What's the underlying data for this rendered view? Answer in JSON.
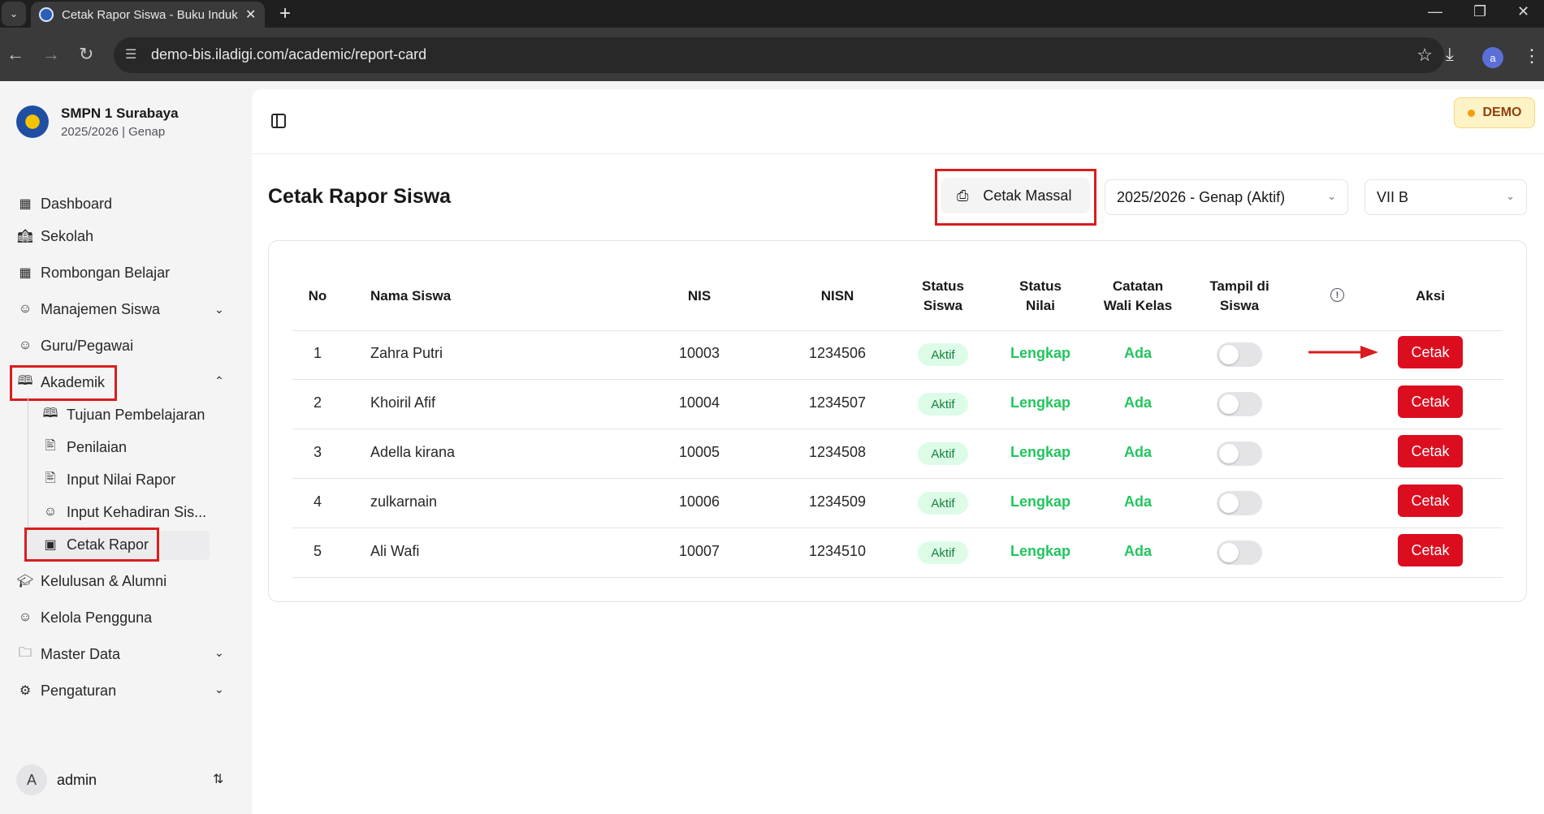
{
  "browser": {
    "tab_title": "Cetak Rapor Siswa - Buku Induk",
    "url": "demo-bis.iladigi.com/academic/report-card",
    "profile_initial": "a"
  },
  "school": {
    "name": "SMPN 1 Surabaya",
    "period": "2025/2026 | Genap"
  },
  "sidebar": {
    "items": [
      {
        "label": "Dashboard",
        "icon": "grid-icon"
      },
      {
        "label": "Sekolah",
        "icon": "school-icon"
      },
      {
        "label": "Rombongan Belajar",
        "icon": "grid-icon"
      },
      {
        "label": "Manajemen Siswa",
        "icon": "users-icon"
      },
      {
        "label": "Guru/Pegawai",
        "icon": "users-icon"
      },
      {
        "label": "Akademik",
        "icon": "book-open-icon"
      },
      {
        "label": "Kelulusan & Alumni",
        "icon": "graduation-cap-icon"
      },
      {
        "label": "Kelola Pengguna",
        "icon": "user-cog-icon"
      },
      {
        "label": "Master Data",
        "icon": "folder-icon"
      },
      {
        "label": "Pengaturan",
        "icon": "gear-icon"
      }
    ],
    "akademik_sub": [
      {
        "label": "Tujuan Pembelajaran",
        "icon": "book-open-icon"
      },
      {
        "label": "Penilaian",
        "icon": "file-text-icon"
      },
      {
        "label": "Input Nilai Rapor",
        "icon": "file-text-icon"
      },
      {
        "label": "Input Kehadiran Sis...",
        "icon": "users-icon"
      },
      {
        "label": "Cetak Rapor",
        "icon": "badge-icon"
      }
    ]
  },
  "user": {
    "initial": "A",
    "name": "admin"
  },
  "header": {
    "demo_label": "DEMO"
  },
  "page": {
    "title": "Cetak Rapor Siswa",
    "bulk_print_label": "Cetak Massal",
    "semester_selected": "2025/2026 - Genap (Aktif)",
    "class_selected": "VII B"
  },
  "table": {
    "headers": {
      "no": "No",
      "nama": "Nama Siswa",
      "nis": "NIS",
      "nisn": "NISN",
      "status_siswa_1": "Status",
      "status_siswa_2": "Siswa",
      "status_nilai_1": "Status",
      "status_nilai_2": "Nilai",
      "catatan_1": "Catatan",
      "catatan_2": "Wali Kelas",
      "tampil_1": "Tampil di",
      "tampil_2": "Siswa",
      "aksi": "Aksi"
    },
    "rows": [
      {
        "no": "1",
        "nama": "Zahra Putri",
        "nis": "10003",
        "nisn": "1234506",
        "status_siswa": "Aktif",
        "status_nilai": "Lengkap",
        "catatan": "Ada",
        "tampil": false,
        "aksi": "Cetak"
      },
      {
        "no": "2",
        "nama": "Khoiril Afif",
        "nis": "10004",
        "nisn": "1234507",
        "status_siswa": "Aktif",
        "status_nilai": "Lengkap",
        "catatan": "Ada",
        "tampil": false,
        "aksi": "Cetak"
      },
      {
        "no": "3",
        "nama": "Adella kirana",
        "nis": "10005",
        "nisn": "1234508",
        "status_siswa": "Aktif",
        "status_nilai": "Lengkap",
        "catatan": "Ada",
        "tampil": false,
        "aksi": "Cetak"
      },
      {
        "no": "4",
        "nama": "zulkarnain",
        "nis": "10006",
        "nisn": "1234509",
        "status_siswa": "Aktif",
        "status_nilai": "Lengkap",
        "catatan": "Ada",
        "tampil": false,
        "aksi": "Cetak"
      },
      {
        "no": "5",
        "nama": "Ali Wafi",
        "nis": "10007",
        "nisn": "1234510",
        "status_siswa": "Aktif",
        "status_nilai": "Lengkap",
        "catatan": "Ada",
        "tampil": false,
        "aksi": "Cetak"
      }
    ]
  },
  "colors": {
    "accent_red": "#dc0d1f",
    "status_green": "#22c55e",
    "annotation_red": "#d91d1d"
  }
}
